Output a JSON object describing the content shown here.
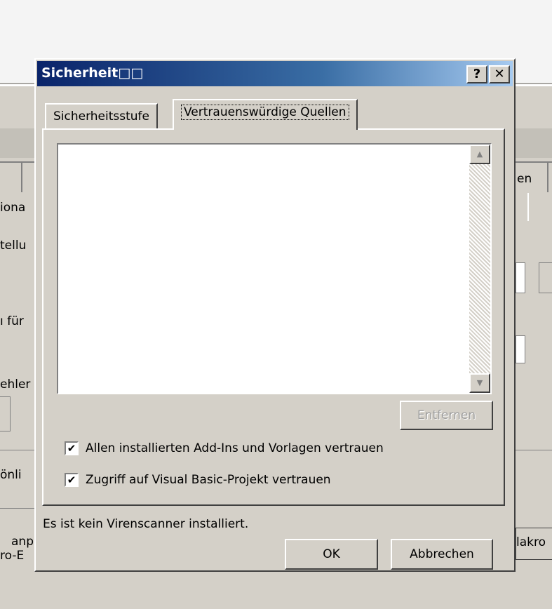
{
  "dialog": {
    "title": "Sicherheit□□",
    "help_label": "?",
    "close_label": "✕",
    "tabs": [
      {
        "label": "Sicherheitsstufe"
      },
      {
        "label": "Vertrauenswürdige Quellen"
      }
    ],
    "sources_list": {
      "items": [],
      "scroll_up": "▲",
      "scroll_down": "▼"
    },
    "remove_label": "Entfernen",
    "checkboxes": [
      {
        "label": "Allen installierten Add-Ins und Vorlagen vertrauen",
        "checked": true
      },
      {
        "label": "Zugriff auf Visual Basic-Projekt vertrauen",
        "checked": true
      }
    ],
    "check_mark": "✔",
    "status_text": "Es ist kein Virenscanner installiert.",
    "ok_label": "OK",
    "cancel_label": "Abbrechen"
  },
  "background": {
    "fragments": [
      "iona",
      "tellu",
      "ı für",
      "ehler",
      "önli",
      "anp",
      "ro-E",
      "en",
      "lakro"
    ]
  }
}
